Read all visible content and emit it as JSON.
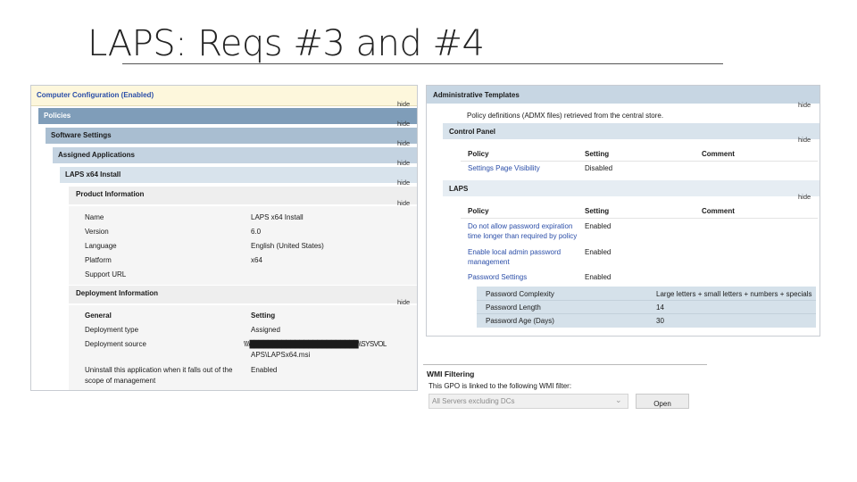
{
  "slide": {
    "title": "LAPS: Reqs #3 and #4"
  },
  "left_report": {
    "computer_config": "Computer Configuration (Enabled)",
    "policies": "Policies",
    "software_settings": "Software Settings",
    "assigned_apps": "Assigned Applications",
    "app_name": "LAPS x64 Install",
    "product_info": "Product Information",
    "hide": "hide",
    "product_rows": [
      {
        "label": "Name",
        "value": "LAPS x64 Install"
      },
      {
        "label": "Version",
        "value": "6.0"
      },
      {
        "label": "Language",
        "value": "English (United States)"
      },
      {
        "label": "Platform",
        "value": "x64"
      },
      {
        "label": "Support URL",
        "value": ""
      }
    ],
    "deployment_info": "Deployment Information",
    "deploy_headers": {
      "general": "General",
      "setting": "Setting"
    },
    "deploy_rows": [
      {
        "label": "Deployment type",
        "value": "Assigned"
      },
      {
        "label": "Deployment source",
        "value_line1": "\\\\\\\\████████████████████████\\\\SYSVOL",
        "value_line2": "APS\\LAPSx64.msi"
      },
      {
        "label": "Uninstall this application when it falls out of the",
        "label2": "scope of management",
        "value": "Enabled"
      }
    ]
  },
  "right_report": {
    "admin_templates": "Administrative Templates",
    "policy_defs": "Policy definitions (ADMX files) retrieved from the central store.",
    "control_panel": "Control Panel",
    "cp_headers": {
      "policy": "Policy",
      "setting": "Setting",
      "comment": "Comment"
    },
    "cp_row": {
      "policy": "Settings Page Visibility",
      "setting": "Disabled"
    },
    "laps": "LAPS",
    "laps_headers": {
      "policy": "Policy",
      "setting": "Setting",
      "comment": "Comment"
    },
    "laps_rows": [
      {
        "policy_line1": "Do not allow password expiration",
        "policy_line2": "time longer than required by policy",
        "setting": "Enabled"
      },
      {
        "policy_line1": "Enable local admin password",
        "policy_line2": "management",
        "setting": "Enabled"
      },
      {
        "policy_line1": "Password Settings",
        "setting": "Enabled"
      }
    ],
    "password_settings": [
      {
        "name": "Password Complexity",
        "value": "Large letters + small letters + numbers + specials"
      },
      {
        "name": "Password Length",
        "value": "14"
      },
      {
        "name": "Password Age (Days)",
        "value": "30"
      }
    ],
    "hide": "hide"
  },
  "wmi": {
    "heading": "WMI Filtering",
    "description": "This GPO is linked to the following WMI filter:",
    "selected_filter": "All Servers excluding DCs",
    "open_button": "Open"
  }
}
